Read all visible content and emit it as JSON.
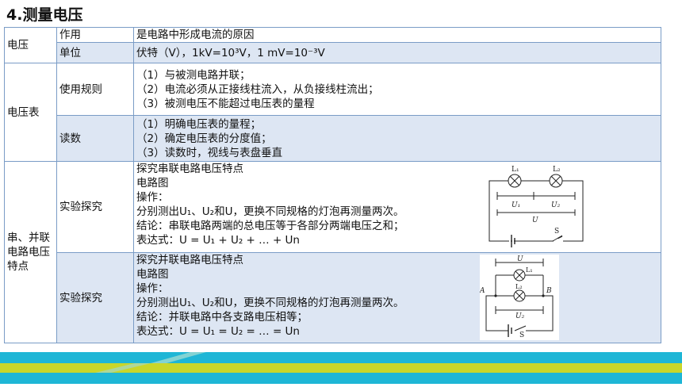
{
  "title": "4.测量电压",
  "rows": {
    "voltage": {
      "label": "电压",
      "effect_label": "作用",
      "effect_value": "是电路中形成电流的原因",
      "unit_label": "单位",
      "unit_value": "伏特（V），1kV=10³V，1 mV=10⁻³V"
    },
    "voltmeter": {
      "label": "电压表",
      "usage_label": "使用规则",
      "usage_lines": [
        "（1）与被测电路并联；",
        "（2）电流必须从正接线柱流入，从负接线柱流出；",
        "（3）被测电压不能超过电压表的量程"
      ],
      "reading_label": "读数",
      "reading_lines": [
        "（1）明确电压表的量程；",
        "（2）确定电压表的分度值；",
        "（3）读数时，视线与表盘垂直"
      ]
    },
    "circuits": {
      "label": "串、并联电路电压特点",
      "series": {
        "label": "实验探究",
        "line1": "探究串联电路电压特点",
        "line2": "电路图",
        "line3": "操作：",
        "line4": "分别测出U₁、U₂和U，更换不同规格的灯泡再测量两次。",
        "line5": "结论：串联电路两端的总电压等于各部分两端电压之和；",
        "line6": "表达式：U = U₁ + U₂ + … + Un"
      },
      "parallel": {
        "label": "实验探究",
        "line1": "探究并联电路电压特点",
        "line2": "电路图",
        "line3": "操作：",
        "line4": "分别测出U₁、U₂和U，更换不同规格的灯泡再测量两次。",
        "line5": "结论：并联电路中各支路电压相等；",
        "line6": "表达式：U = U₁ = U₂ = … = Un"
      }
    }
  },
  "diagram_labels": {
    "series": {
      "l1": "L₁",
      "l2": "L₂",
      "u1": "U₁",
      "u2": "U₂",
      "u": "U",
      "s": "S"
    },
    "parallel": {
      "u": "U",
      "l1": "L₁",
      "l2": "L₂",
      "u2": "U₂",
      "a": "A",
      "b": "B",
      "s": "S"
    }
  },
  "colors": {
    "border": "#7a9cc6",
    "row_alt": "#dde6f3",
    "band_cyan": "#1eb6d6",
    "band_yellow": "#c9d62a"
  }
}
